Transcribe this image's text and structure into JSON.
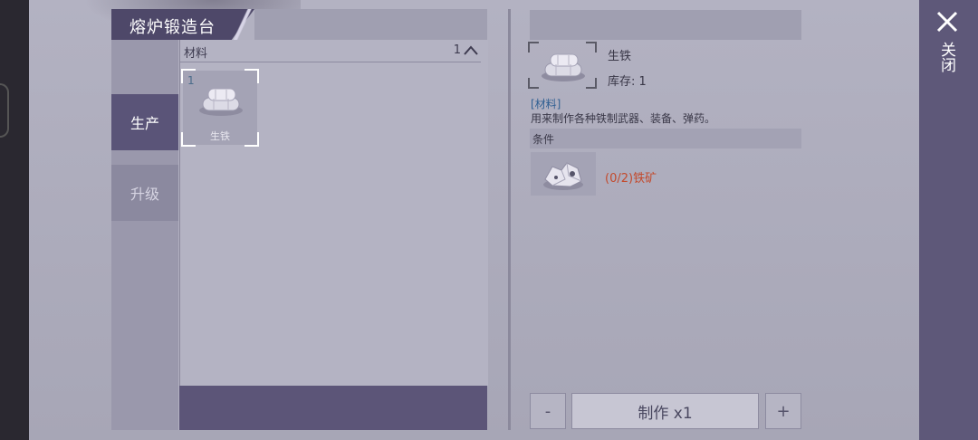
{
  "window": {
    "title": "熔炉锻造台",
    "close_label": "关闭"
  },
  "tabs": [
    {
      "label": "生产",
      "active": true
    },
    {
      "label": "升级",
      "active": false
    }
  ],
  "material_list": {
    "category_label": "材料",
    "category_count": "1",
    "items": [
      {
        "count": "1",
        "name": "生铁",
        "icon": "pig-iron-ingot-icon"
      }
    ]
  },
  "detail": {
    "name": "生铁",
    "stock": "库存: 1",
    "type": "[材料]",
    "description": "用来制作各种铁制武器、装备、弹药。",
    "conditions_label": "条件",
    "requirements": [
      {
        "text": "(0/2)铁矿",
        "icon": "iron-ore-icon",
        "status_color": "#c34a2c"
      }
    ]
  },
  "controls": {
    "minus": "-",
    "craft": "制作 x1",
    "plus": "+"
  },
  "colors": {
    "accent": "#5a5478",
    "requirement_unmet": "#c34a2c",
    "type_tag": "#2f5f92"
  }
}
